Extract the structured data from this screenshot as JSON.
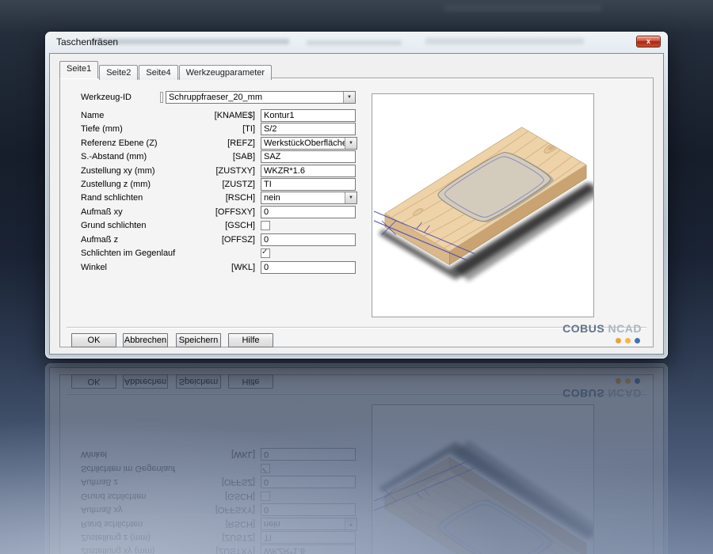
{
  "window": {
    "title": "Taschenfräsen"
  },
  "icons": {
    "close": "x",
    "dropdown": "▼",
    "check": "✓"
  },
  "tabs": [
    {
      "label": "Seite1",
      "active": true
    },
    {
      "label": "Seite2",
      "active": false
    },
    {
      "label": "Seite4",
      "active": false
    },
    {
      "label": "Werkzeugparameter",
      "active": false
    }
  ],
  "form": {
    "rows": [
      {
        "label": "Werkzeug-ID",
        "param": "",
        "type": "select",
        "value": "Schruppfraeser_20_mm"
      },
      {
        "label": "Name",
        "param": "[KNAME$]",
        "type": "text",
        "value": "Kontur1"
      },
      {
        "label": "Tiefe (mm)",
        "param": "[TI]",
        "type": "text",
        "value": "S/2"
      },
      {
        "label": "Referenz Ebene (Z)",
        "param": "[REFZ]",
        "type": "select",
        "value": "WerkstückOberfläche"
      },
      {
        "label": "S.-Abstand (mm)",
        "param": "[SAB]",
        "type": "text",
        "value": "SAZ"
      },
      {
        "label": "Zustellung xy (mm)",
        "param": "[ZUSTXY]",
        "type": "text",
        "value": "WKZR*1.6"
      },
      {
        "label": "Zustellung z (mm)",
        "param": "[ZUSTZ]",
        "type": "text",
        "value": "TI"
      },
      {
        "label": "Rand schlichten",
        "param": "[RSCH]",
        "type": "select",
        "value": "nein"
      },
      {
        "label": "Aufmaß xy",
        "param": "[OFFSXY]",
        "type": "text",
        "value": "0"
      },
      {
        "label": "Grund schlichten",
        "param": "[GSCH]",
        "type": "checkbox",
        "checked": false
      },
      {
        "label": "Aufmaß z",
        "param": "[OFFSZ]",
        "type": "text",
        "value": "0"
      },
      {
        "label": "Schlichten im Gegenlauf",
        "param": "",
        "type": "checkbox",
        "checked": true
      },
      {
        "label": "Winkel",
        "param": "[WKL]",
        "type": "text",
        "value": "0"
      }
    ]
  },
  "buttons": [
    "OK",
    "Abbrechen",
    "Speichern",
    "Hilfe"
  ],
  "branding": {
    "name1": "COBUS",
    "name2": "NCAD",
    "dot_colors": [
      "#e8a23c",
      "#f0b844",
      "#3f72b8"
    ]
  },
  "preview_colors": {
    "wood": "#eed3a8",
    "pocket": "#d3ccbd",
    "contour_line": "#4a4aae"
  }
}
